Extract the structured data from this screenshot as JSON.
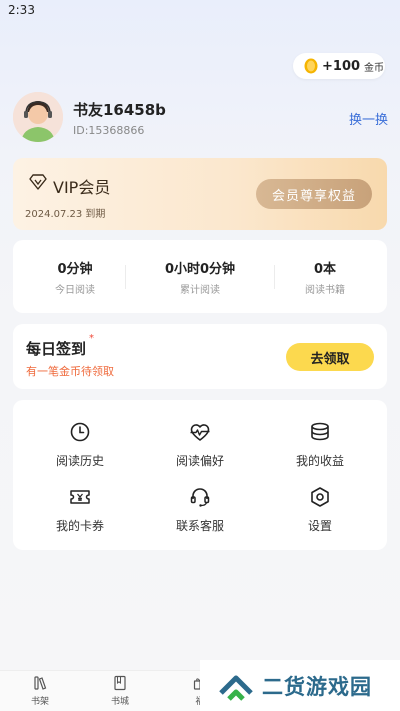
{
  "status_bar": {
    "time": "2:33"
  },
  "coins": {
    "amount": "+100",
    "unit": "金币"
  },
  "profile": {
    "username": "书友16458b",
    "user_id": "ID:15368866",
    "switch_label": "换一换"
  },
  "vip": {
    "title": "VIP会员",
    "expire": "2024.07.23 到期",
    "button_label": "会员尊享权益"
  },
  "stats": [
    {
      "value": "0分钟",
      "label": "今日阅读"
    },
    {
      "value": "0小时0分钟",
      "label": "累计阅读"
    },
    {
      "value": "0本",
      "label": "阅读书籍"
    }
  ],
  "checkin": {
    "title": "每日签到",
    "star": "*",
    "subtitle": "有一笔金币待领取",
    "button_label": "去领取"
  },
  "menu": [
    {
      "label": "阅读历史",
      "icon": "clock-icon"
    },
    {
      "label": "阅读偏好",
      "icon": "heart-pulse-icon"
    },
    {
      "label": "我的收益",
      "icon": "coin-stack-icon"
    },
    {
      "label": "我的卡券",
      "icon": "ticket-icon"
    },
    {
      "label": "联系客服",
      "icon": "headset-icon"
    },
    {
      "label": "设置",
      "icon": "settings-icon"
    }
  ],
  "tabbar": [
    {
      "label": "书架",
      "icon": "bookshelf-icon"
    },
    {
      "label": "书城",
      "icon": "book-icon"
    },
    {
      "label": "福",
      "icon": "gift-icon"
    }
  ],
  "watermark": {
    "text": "二货游戏园"
  },
  "colors": {
    "accent_blue": "#3b6fd8",
    "vip_button": "#c8a27a",
    "checkin_button": "#fcd94e",
    "checkin_subtitle": "#ef6a3c",
    "watermark_text": "#2c6a8c"
  }
}
